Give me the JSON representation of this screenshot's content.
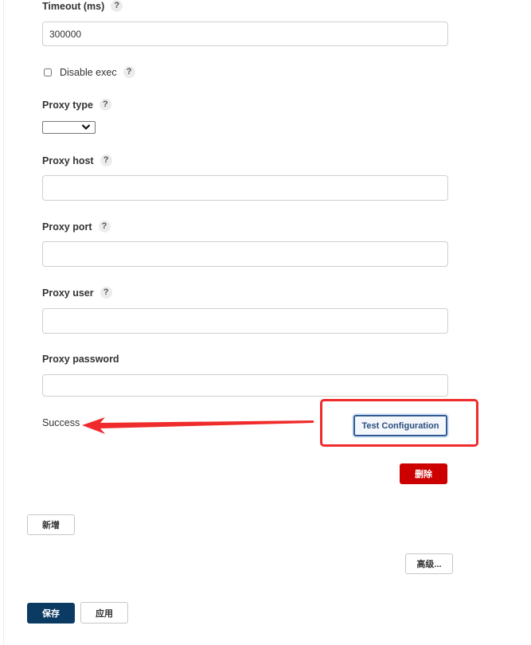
{
  "fields": {
    "timeout": {
      "label": "Timeout (ms)",
      "value": "300000"
    },
    "disable_exec": {
      "label": "Disable exec",
      "checked": false
    },
    "proxy_type": {
      "label": "Proxy type",
      "selected": ""
    },
    "proxy_host": {
      "label": "Proxy host",
      "value": ""
    },
    "proxy_port": {
      "label": "Proxy port",
      "value": ""
    },
    "proxy_user": {
      "label": "Proxy user",
      "value": ""
    },
    "proxy_password": {
      "label": "Proxy password",
      "value": ""
    }
  },
  "help_glyph": "?",
  "status": {
    "text": "Success"
  },
  "buttons": {
    "test_configuration": "Test Configuration",
    "delete": "删除",
    "add": "新增",
    "advanced": "高级...",
    "save": "保存",
    "apply": "应用"
  },
  "icons": {
    "help": "help-icon",
    "chevron": "chevron-down-icon",
    "arrow": "annotation-arrow"
  },
  "colors": {
    "annotation_red": "#ef2b2b",
    "delete_red": "#cc0000",
    "save_navy": "#0b3a63",
    "test_border": "#2e5b95"
  }
}
